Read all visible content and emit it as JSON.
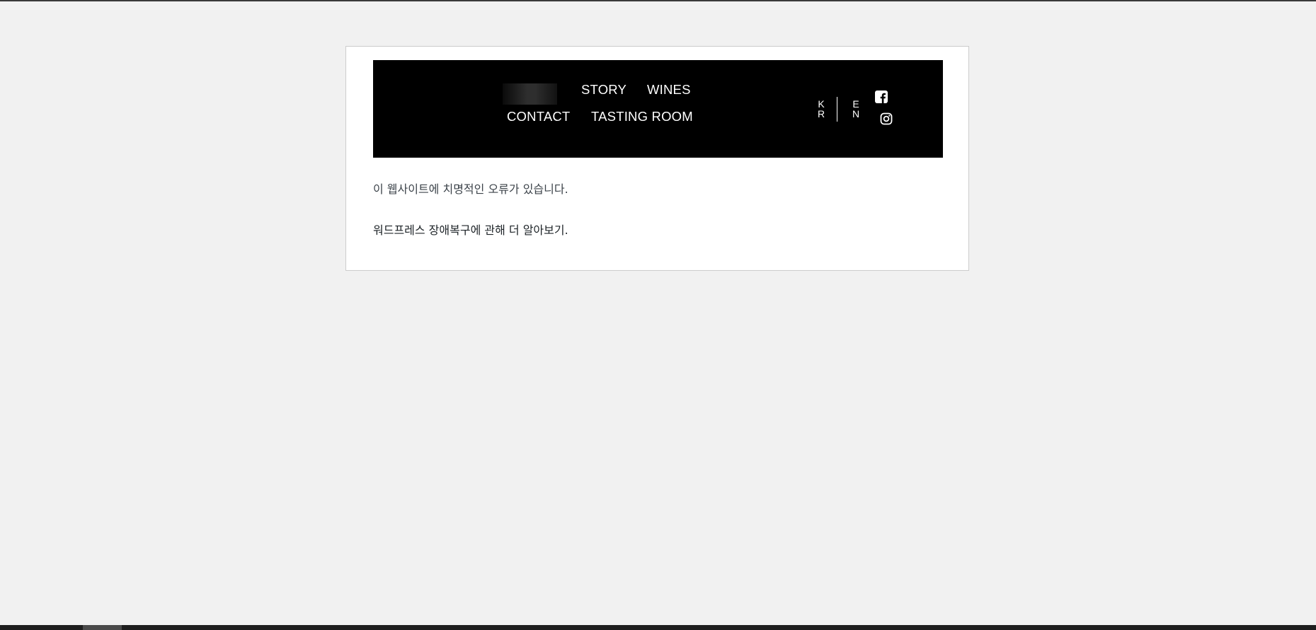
{
  "header": {
    "nav": {
      "story": "STORY",
      "wines": "WINES",
      "contact": "CONTACT",
      "tasting_room": "TASTING ROOM"
    },
    "language": {
      "kr": "KR",
      "en": "EN"
    },
    "social": [
      "facebook-icon",
      "instagram-icon"
    ]
  },
  "error": {
    "message": "이 웹사이트에 치명적인 오류가 있습니다.",
    "link_text": "워드프레스 장애복구에 관해 더 알아보기."
  },
  "colors": {
    "page_background": "#f1f1f1",
    "header_background": "#000000",
    "header_text": "#ffffff",
    "error_text": "#3c434a",
    "link_text": "#1d2327"
  }
}
